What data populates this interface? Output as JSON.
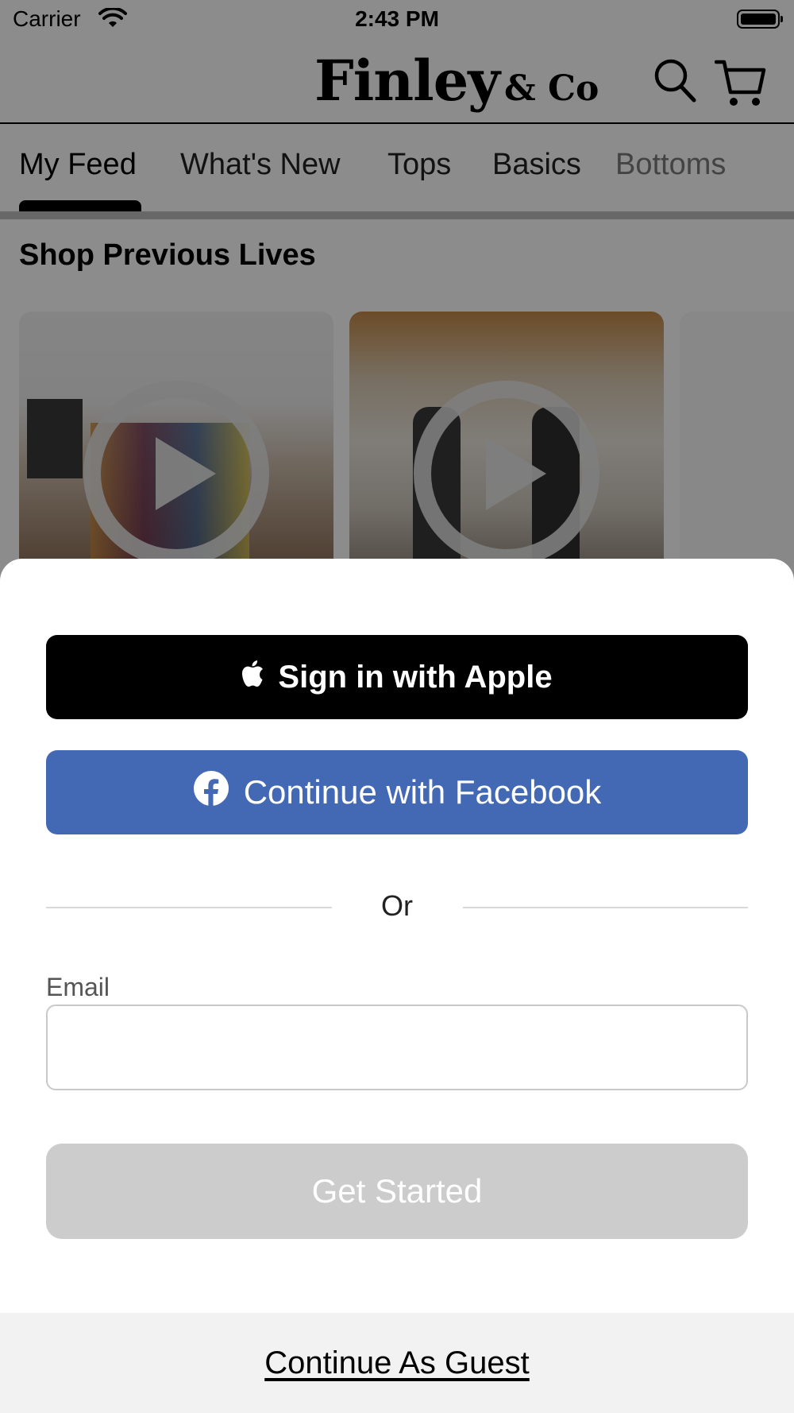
{
  "status_bar": {
    "carrier": "Carrier",
    "time": "2:43 PM"
  },
  "header": {
    "logo_main": "Finley",
    "logo_sub": "& Co",
    "icons": [
      "search-icon",
      "cart-icon"
    ]
  },
  "tabs": [
    {
      "label": "My Feed",
      "active": true
    },
    {
      "label": "What's New",
      "active": false
    },
    {
      "label": "Tops",
      "active": false
    },
    {
      "label": "Basics",
      "active": false
    },
    {
      "label": "Bottoms",
      "active": false
    }
  ],
  "feed": {
    "section_title": "Shop Previous Lives"
  },
  "login_sheet": {
    "apple_button": "Sign in with Apple",
    "facebook_button": "Continue with Facebook",
    "divider_text": "Or",
    "email_label": "Email",
    "email_value": "",
    "email_placeholder": "",
    "get_started_button": "Get Started",
    "guest_link": "Continue As Guest"
  },
  "colors": {
    "facebook_blue": "#4469b4",
    "apple_black": "#000000",
    "disabled_button": "#cccccc",
    "guest_bar_bg": "#f2f2f2"
  }
}
